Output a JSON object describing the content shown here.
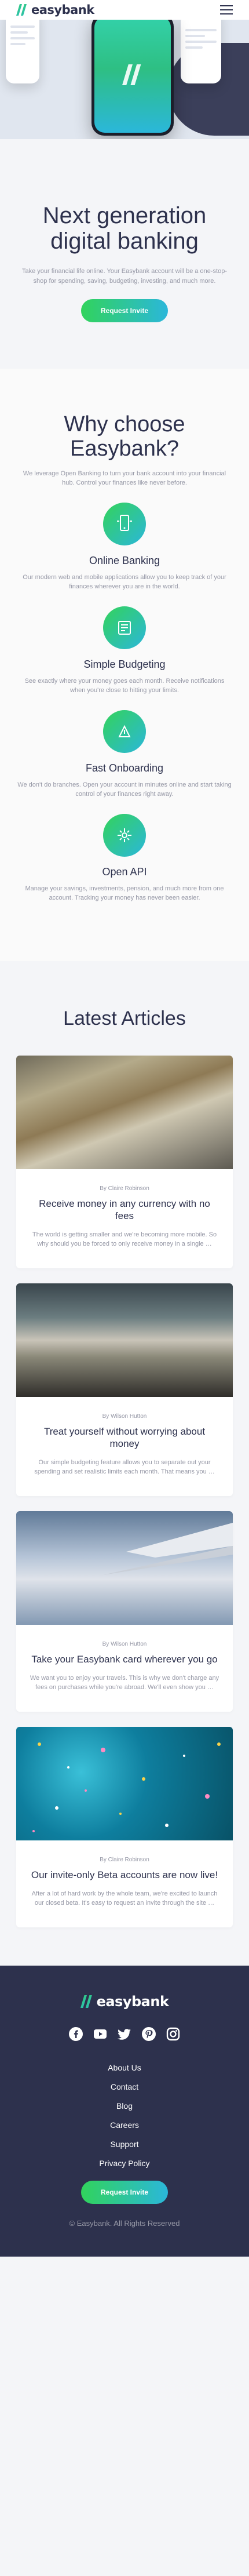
{
  "header": {
    "logo_text": "easybank",
    "menu_icon": "hamburger-icon"
  },
  "hero": {
    "title": "Next generation digital banking",
    "description": "Take your financial life online. Your Easybank account will be a one-stop-shop for spending, saving, budgeting, investing, and much more.",
    "cta": "Request Invite"
  },
  "why": {
    "title": "Why choose Easybank?",
    "lead": "We leverage Open Banking to turn your bank account into your financial hub. Control your finances like never before.",
    "features": [
      {
        "icon": "online-banking-icon",
        "title": "Online Banking",
        "text": "Our modern web and mobile applications allow you to keep track of your finances wherever you are in the world."
      },
      {
        "icon": "budgeting-icon",
        "title": "Simple Budgeting",
        "text": "See exactly where your money goes each month. Receive notifications when you're close to hitting your limits."
      },
      {
        "icon": "onboarding-icon",
        "title": "Fast Onboarding",
        "text": "We don't do branches. Open your account in minutes online and start taking control of your finances right away."
      },
      {
        "icon": "api-icon",
        "title": "Open API",
        "text": "Manage your savings, investments, pension, and much more from one account. Tracking your money has never been easier."
      }
    ]
  },
  "articles": {
    "title": "Latest Articles",
    "items": [
      {
        "author": "By Claire Robinson",
        "title": "Receive money in any currency with no fees",
        "excerpt": "The world is getting smaller and we're becoming more mobile. So why should you be forced to only receive money in a single …"
      },
      {
        "author": "By Wilson Hutton",
        "title": "Treat yourself without worrying about money",
        "excerpt": "Our simple budgeting feature allows you to separate out your spending and set realistic limits each month. That means you …"
      },
      {
        "author": "By Wilson Hutton",
        "title": "Take your Easybank card wherever you go",
        "excerpt": "We want you to enjoy your travels. This is why we don't charge any fees on purchases while you're abroad. We'll even show you …"
      },
      {
        "author": "By Claire Robinson",
        "title": "Our invite-only Beta accounts are now live!",
        "excerpt": "After a lot of hard work by the whole team, we're excited to launch our closed beta. It's easy to request an invite through the site …"
      }
    ]
  },
  "footer": {
    "logo_text": "easybank",
    "socials": [
      "facebook-icon",
      "youtube-icon",
      "twitter-icon",
      "pinterest-icon",
      "instagram-icon"
    ],
    "links": [
      "About Us",
      "Contact",
      "Blog",
      "Careers",
      "Support",
      "Privacy Policy"
    ],
    "cta": "Request Invite",
    "copyright": "© Easybank. All Rights Reserved"
  },
  "colors": {
    "dark_blue": "#2d314d",
    "lime_green": "#31d35c",
    "bright_cyan": "#2bb7da",
    "grayish_blue": "#9698a6",
    "light_gray": "#f4f5f8"
  }
}
